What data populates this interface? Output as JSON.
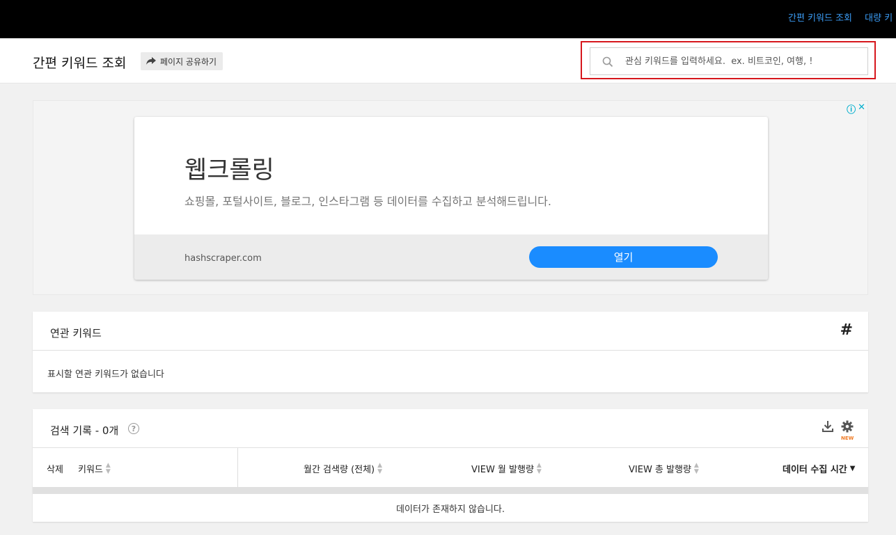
{
  "topbar": {
    "nav": [
      "간편 키워드 조회",
      "대량 키"
    ]
  },
  "header": {
    "title": "간편 키워드 조회",
    "share_label": "페이지 공유하기",
    "search_placeholder": "관심 키워드를 입력하세요.  ex. 비트코인, 여행, !"
  },
  "ad": {
    "title": "웹크롤링",
    "description": "쇼핑몰, 포털사이트, 블로그, 인스타그램 등 데이터를 수집하고 분석해드립니다.",
    "domain": "hashscraper.com",
    "button": "열기",
    "info": "ⓘ",
    "close": "✕"
  },
  "related": {
    "title": "연관 키워드",
    "hash_symbol": "#",
    "empty_message": "표시할 연관 키워드가 없습니다"
  },
  "history": {
    "title": "검색 기록 - 0개",
    "help": "?",
    "new_badge": "NEW",
    "columns": {
      "delete": "삭제",
      "keyword": "키워드",
      "monthly_search": "월간 검색량 (전체)",
      "view_monthly": "VIEW 월 발행량",
      "view_total": "VIEW 총 발행량",
      "collected_time": "데이터 수집 시간"
    },
    "empty_message": "데이터가 존재하지 않습니다."
  },
  "colors": {
    "topbar": "#000000",
    "nav_link": "#3b9cf5",
    "highlight": "#d6161c",
    "ad_button": "#1a8cff",
    "new_badge": "#f07b25"
  }
}
